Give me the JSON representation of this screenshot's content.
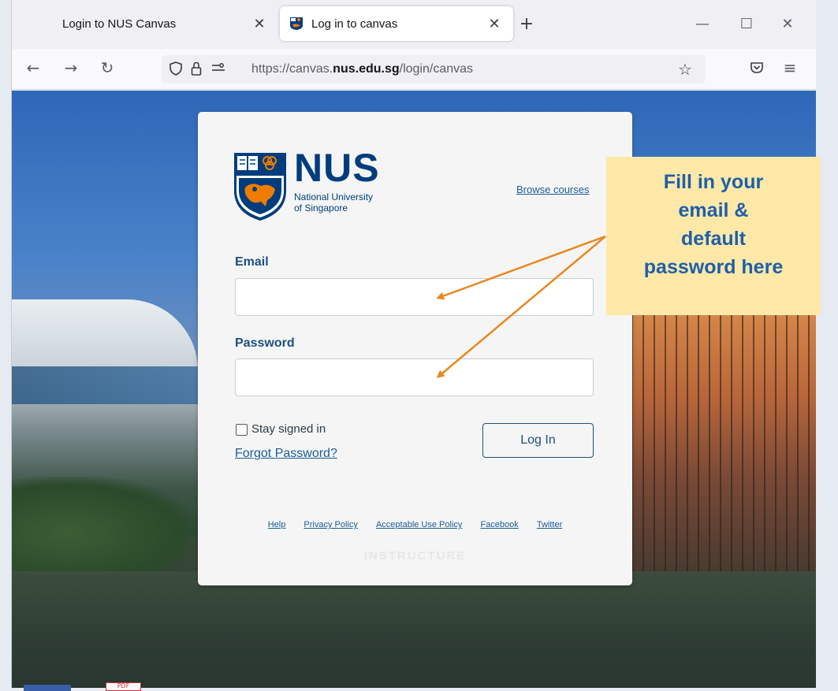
{
  "browser": {
    "tabs": [
      {
        "label": "Login to NUS Canvas",
        "active": false
      },
      {
        "label": "Log in to canvas",
        "active": true
      }
    ],
    "new_tab_glyph": "+",
    "url": {
      "scheme": "https://canvas.",
      "domain": "nus.edu.sg",
      "path": "/login/canvas"
    },
    "icons": [
      "back-arrow-icon",
      "forward-arrow-icon",
      "reload-icon",
      "shield-icon",
      "lock-icon",
      "permissions-icon",
      "bookmark-star-icon",
      "pocket-icon",
      "menu-icon"
    ]
  },
  "login": {
    "logo": {
      "title": "NUS",
      "subtitle_line1": "National University",
      "subtitle_line2": "of Singapore"
    },
    "browse_courses": "Browse courses",
    "email_label": "Email",
    "email_value": "",
    "password_label": "Password",
    "password_value": "",
    "stay_signed_in": "Stay signed in",
    "forgot_password": "Forgot Password?",
    "login_button": "Log In",
    "footer_links": [
      "Help",
      "Privacy Policy",
      "Acceptable Use Policy",
      "Facebook",
      "Twitter"
    ],
    "powered_by": "INSTRUCTURE"
  },
  "annotation": {
    "lines": [
      "Fill in your",
      "email &",
      "default",
      "password here"
    ],
    "arrow_color": "#e8871e",
    "box_color": "#fde8a8",
    "text_color": "#1f5fa8"
  },
  "taskbar": {
    "pdf_label": "PDF"
  }
}
